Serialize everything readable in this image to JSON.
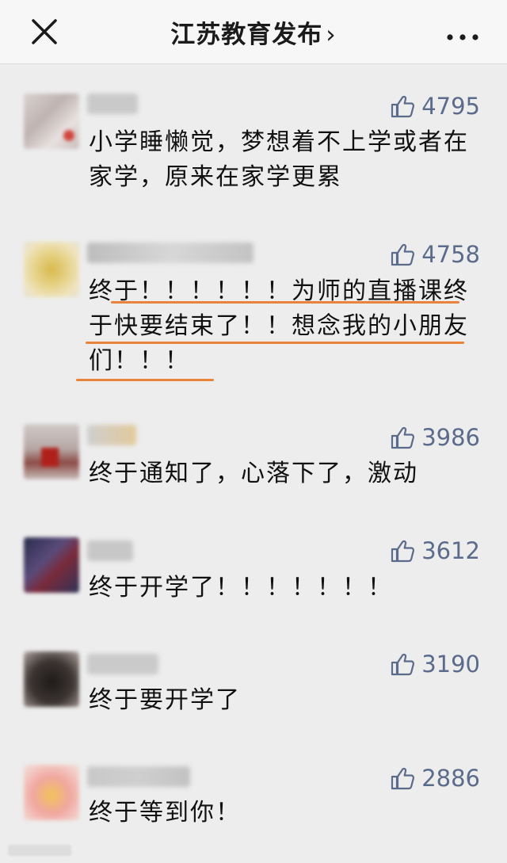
{
  "header": {
    "title": "江苏教育发布",
    "chevron": "›",
    "close_icon": "close-icon",
    "more_icon": "more-icon"
  },
  "comments": [
    {
      "likes": "4795",
      "text": "小学睡懒觉，梦想着不上学或者在家学，原来在家学更累"
    },
    {
      "likes": "4758",
      "text": "终于！！！！！！为师的直播课终于快要结束了！！想念我的小朋友们！！！"
    },
    {
      "likes": "3986",
      "text": "终于通知了，心落下了，激动"
    },
    {
      "likes": "3612",
      "text": "终于开学了！！！！！！！"
    },
    {
      "likes": "3190",
      "text": "终于要开学了"
    },
    {
      "likes": "2886",
      "text": "终于等到你！"
    }
  ],
  "colors": {
    "accent_underline": "#e8833a",
    "like_color": "#5b6b8b",
    "background": "#ededed"
  },
  "icons": {
    "like": "thumbs-up-icon"
  }
}
